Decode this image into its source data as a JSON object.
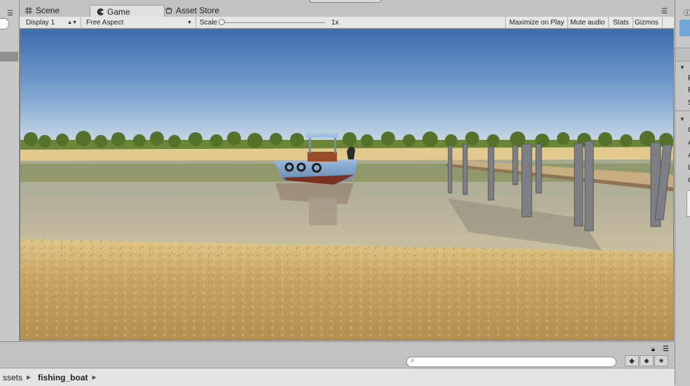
{
  "tabs": [
    {
      "label": "Scene",
      "icon": "grid-icon"
    },
    {
      "label": "Game",
      "icon": "pacman-icon",
      "active": true
    },
    {
      "label": "Asset Store",
      "icon": "store-icon"
    }
  ],
  "toolbar": {
    "display": "Display 1",
    "aspect": "Free Aspect",
    "scale_label": "Scale",
    "scale_value": "1x",
    "maximize": "Maximize on Play",
    "mute": "Mute audio",
    "stats": "Stats",
    "gizmos": "Gizmos"
  },
  "inspector_letters": [
    "P",
    "P",
    "S",
    "C",
    "A",
    "A",
    "U",
    "C"
  ],
  "breadcrumb": {
    "root": "ssets",
    "current": "fishing_boat"
  },
  "colors": {
    "sky_top": "#3f6fb0",
    "sky_bottom": "#c9dbe8",
    "water": "#9aa38f",
    "sand": "#c9a868",
    "boat_hull": "#7a9ec8",
    "boat_bottom": "#7a3020"
  }
}
